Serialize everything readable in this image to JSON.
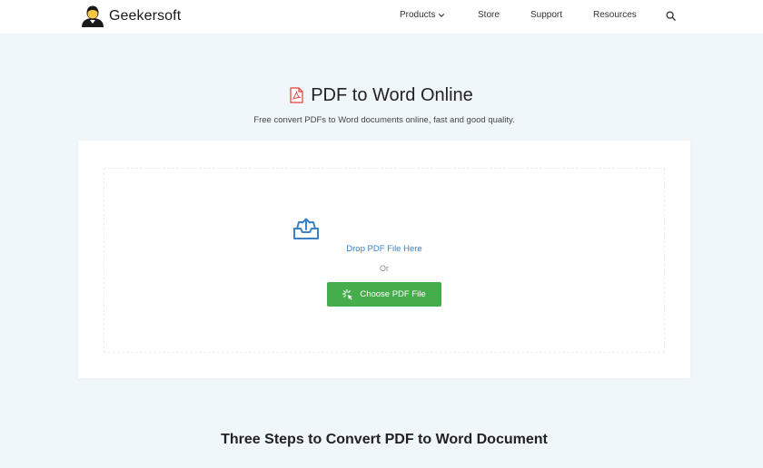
{
  "brand": {
    "name": "Geekersoft"
  },
  "nav": {
    "items": [
      {
        "label": "Products",
        "has_dropdown": true
      },
      {
        "label": "Store"
      },
      {
        "label": "Support"
      },
      {
        "label": "Resources"
      }
    ],
    "search_icon": "search-icon"
  },
  "hero": {
    "title": "PDF to Word Online",
    "subtitle": "Free convert PDFs to Word documents online, fast and good quality."
  },
  "upload": {
    "drop_label": "Drop PDF File Here",
    "or_label": "Or",
    "button_label": "Choose PDF File",
    "icons": [
      "inbox-upload-icon",
      "click-cursor-icon"
    ]
  },
  "steps": {
    "title": "Three Steps to Convert PDF to Word Document"
  },
  "colors": {
    "page_bg": "#f0f7fa",
    "button_green": "#46ad4d",
    "link_blue": "#3b82c4",
    "pdf_red": "#e0403a"
  }
}
